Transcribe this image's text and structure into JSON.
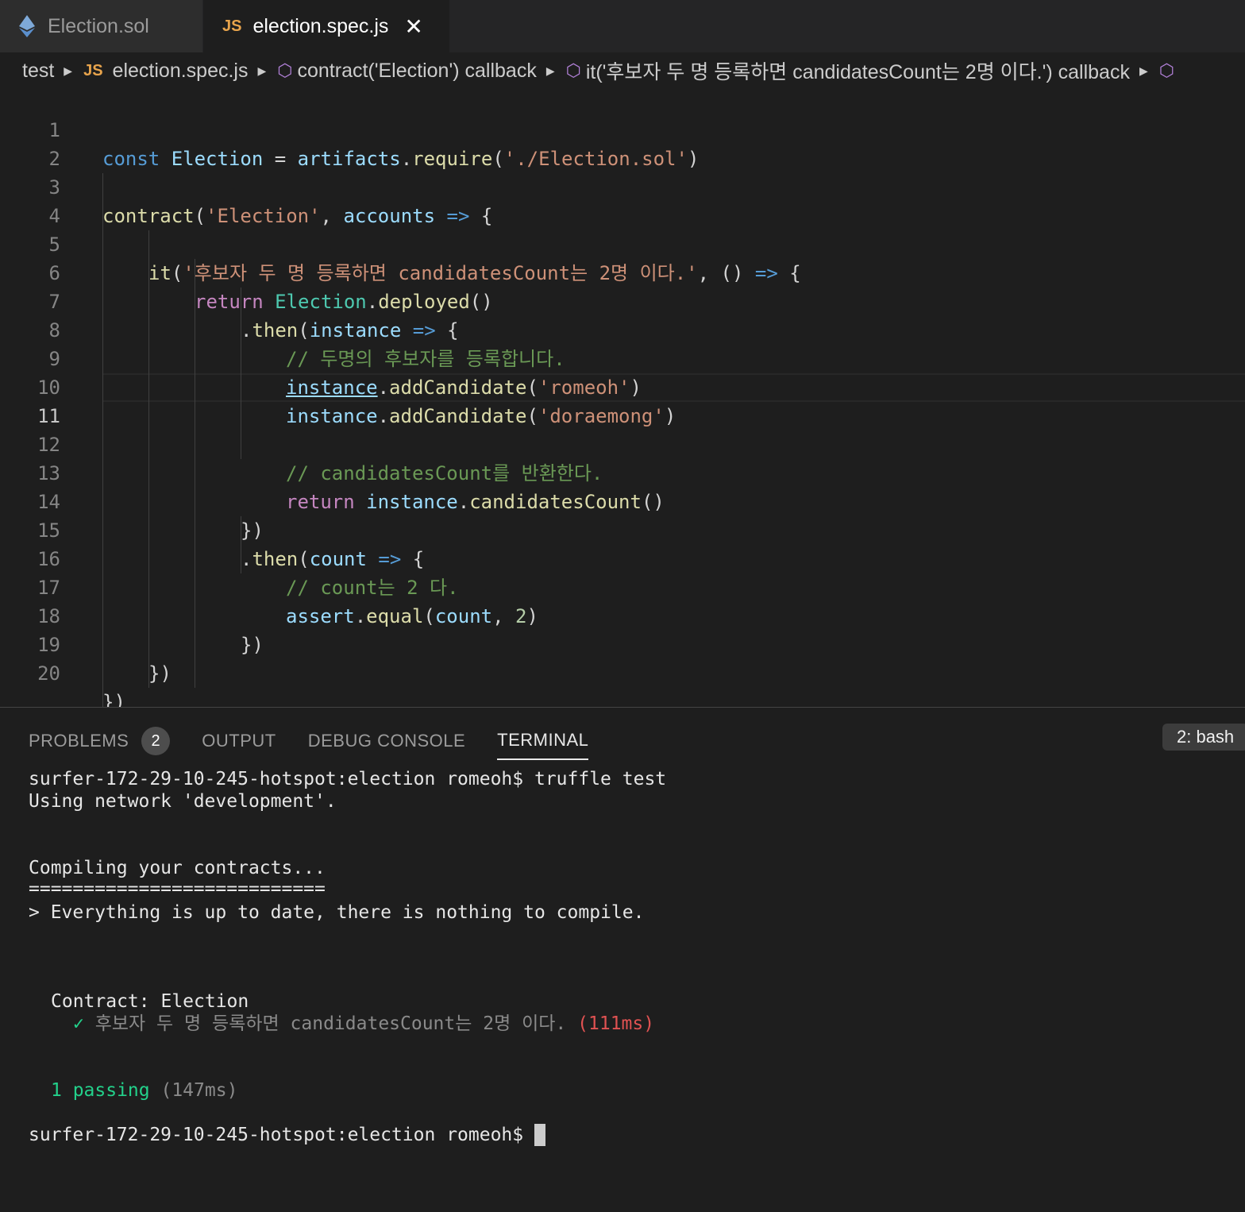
{
  "tabs": [
    {
      "label": "Election.sol",
      "icon": "ethereum-icon",
      "active": false
    },
    {
      "label": "election.spec.js",
      "icon": "js-icon",
      "active": true,
      "close": "✕"
    }
  ],
  "tab_js_badge": "JS",
  "breadcrumb": {
    "folder": "test",
    "js_badge": "JS",
    "file": "election.spec.js",
    "symbol1": "contract('Election') callback",
    "symbol2": "it('후보자 두 명 등록하면 candidatesCount는 2명 이다.') callback"
  },
  "editor": {
    "current_line": 11,
    "lines": [
      {
        "n": "1"
      },
      {
        "n": "2"
      },
      {
        "n": "3"
      },
      {
        "n": "4"
      },
      {
        "n": "5"
      },
      {
        "n": "6"
      },
      {
        "n": "7"
      },
      {
        "n": "8"
      },
      {
        "n": "9"
      },
      {
        "n": "10"
      },
      {
        "n": "11"
      },
      {
        "n": "12"
      },
      {
        "n": "13"
      },
      {
        "n": "14"
      },
      {
        "n": "15"
      },
      {
        "n": "16"
      },
      {
        "n": "17"
      },
      {
        "n": "18"
      },
      {
        "n": "19"
      },
      {
        "n": "20"
      }
    ],
    "code": {
      "l1": [
        "const",
        " Election",
        " = ",
        "artifacts",
        ".",
        "require",
        "(",
        "'./Election.sol'",
        ")"
      ],
      "l3": [
        "contract",
        "(",
        "'Election'",
        ", ",
        "accounts",
        " => ",
        "{"
      ],
      "l5": [
        "it",
        "(",
        "'후보자 두 명 등록하면 candidatesCount는 2명 이다.'",
        ", () ",
        "=>",
        " {"
      ],
      "l6": [
        "return",
        " ",
        "Election",
        ".",
        "deployed",
        "()"
      ],
      "l7": [
        ".",
        "then",
        "(",
        "instance",
        " => ",
        "{"
      ],
      "l8": "// 두명의 후보자를 등록합니다.",
      "l9": [
        "instance",
        ".",
        "addCandidate",
        "(",
        "'romeoh'",
        ")"
      ],
      "l10": [
        "instance",
        ".",
        "addCandidate",
        "(",
        "'doraemong'",
        ")"
      ],
      "l12": "// candidatesCount를 반환한다.",
      "l13": [
        "return",
        " ",
        "instance",
        ".",
        "candidatesCount",
        "()"
      ],
      "l14": "})",
      "l15": [
        ".",
        "then",
        "(",
        "count",
        " => ",
        "{"
      ],
      "l16": "// count는 2 다.",
      "l17": [
        "assert",
        ".",
        "equal",
        "(",
        "count",
        ", ",
        "2",
        ")"
      ],
      "l18": "})",
      "l19": "})",
      "l20": "})"
    }
  },
  "panel": {
    "tabs": [
      "PROBLEMS",
      "OUTPUT",
      "DEBUG CONSOLE",
      "TERMINAL"
    ],
    "problems_count": "2",
    "active_tab": "TERMINAL",
    "terminal_selector": "2: bash"
  },
  "terminal": {
    "prompt": "surfer-172-29-10-245-hotspot:election romeoh$",
    "command": " truffle test",
    "network": "Using network 'development'.",
    "compiling": "Compiling your contracts...",
    "separator": "===========================",
    "up_to_date": "> Everything is up to date, there is nothing to compile.",
    "contract": "Contract: Election",
    "check": "✓",
    "test_name": "후보자 두 명 등록하면 candidatesCount는 2명 이다.",
    "test_time": "(111ms)",
    "passing": "1 passing",
    "passing_time": "(147ms)"
  },
  "colors": {
    "background": "#1e1e1e",
    "keyword": "#569cd6",
    "control": "#c586c0",
    "string": "#ce9178",
    "comment": "#6a9955",
    "function": "#dcdcaa",
    "variable": "#9cdcfe",
    "class": "#4ec9b0",
    "pass_green": "#23d18b",
    "time_red": "#e05252"
  }
}
